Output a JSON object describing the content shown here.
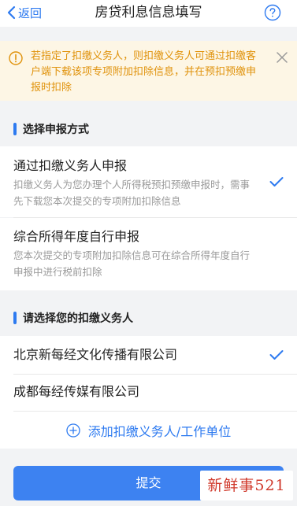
{
  "header": {
    "back_label": "返回",
    "title": "房贷利息信息填写"
  },
  "notice": {
    "text": "若指定了扣缴义务人，则扣缴义务人可通过扣缴客户端下载该项专项附加扣除信息，并在预扣预缴申报时扣除"
  },
  "report_method": {
    "heading": "选择申报方式",
    "options": [
      {
        "title": "通过扣缴义务人申报",
        "desc": "扣缴义务人为您办理个人所得税预扣预缴申报时，需事先下载您本次提交的专项附加扣除信息",
        "selected": true
      },
      {
        "title": "综合所得年度自行申报",
        "desc": "您本次提交的专项附加扣除信息可在综合所得年度自行申报中进行税前扣除",
        "selected": false
      }
    ]
  },
  "withholding": {
    "heading": "请选择您的扣缴义务人",
    "agents": [
      {
        "name": "北京新每经文化传播有限公司",
        "selected": true
      },
      {
        "name": "成都每经传媒有限公司",
        "selected": false
      }
    ],
    "add_label": "添加扣缴义务人/工作单位"
  },
  "submit_label": "提交",
  "watermark": "新鲜事521",
  "colors": {
    "accent": "#2d7af0",
    "warning_text": "#e0920b",
    "warning_bg": "#fdf6e5"
  }
}
